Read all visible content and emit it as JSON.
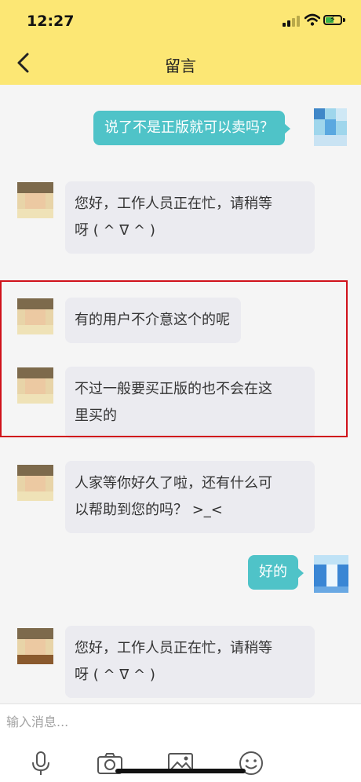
{
  "status": {
    "time": "12:27"
  },
  "header": {
    "title": "留言",
    "back_icon": "chevron-left-icon"
  },
  "messages": [
    {
      "side": "out",
      "lines": [
        "说了不是正版就可以卖吗？"
      ]
    },
    {
      "side": "in",
      "lines": [
        "您好，工作人员正在忙，请稍等",
        "呀 ( ^ ∇ ^ )"
      ]
    },
    {
      "side": "in",
      "lines": [
        "有的用户不介意这个的呢"
      ]
    },
    {
      "side": "in",
      "lines": [
        "不过一般要买正版的也不会在这",
        "里买的"
      ]
    },
    {
      "side": "in",
      "lines": [
        "人家等你好久了啦，还有什么可",
        "以帮助到您的吗？ >_<"
      ]
    },
    {
      "side": "out",
      "lines": [
        "好的"
      ]
    },
    {
      "side": "in",
      "lines": [
        "您好，工作人员正在忙，请稍等",
        "呀 ( ^ ∇ ^ )"
      ]
    }
  ],
  "input": {
    "placeholder": "输入消息..."
  },
  "toolbar": {
    "icons": [
      "microphone-icon",
      "camera-icon",
      "image-icon",
      "emoji-icon"
    ]
  },
  "colors": {
    "header_bg": "#fce774",
    "outgoing_bubble": "#4fc3c8",
    "incoming_bubble": "#ebebf0",
    "highlight_border": "#d0121b"
  }
}
